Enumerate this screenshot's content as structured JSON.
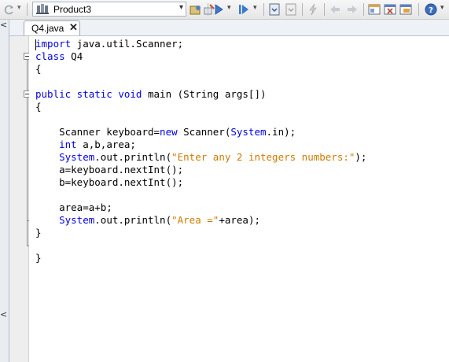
{
  "toolbar": {
    "project_name": "Product3"
  },
  "tab": {
    "label": "Q4.java",
    "close": "✕"
  },
  "code": {
    "lines": [
      [
        {
          "t": "import",
          "k": "kw"
        },
        {
          "t": " java.util.Scanner;",
          "k": "n"
        }
      ],
      [
        {
          "t": "class",
          "k": "kw"
        },
        {
          "t": " Q4",
          "k": "n"
        }
      ],
      [
        {
          "t": "{",
          "k": "n"
        }
      ],
      [],
      [
        {
          "t": "public static void",
          "k": "kw"
        },
        {
          "t": " main (String args[])",
          "k": "n"
        }
      ],
      [
        {
          "t": "{",
          "k": "n"
        }
      ],
      [],
      [
        {
          "t": "    Scanner keyboard",
          "k": "n"
        },
        {
          "t": "=",
          "k": "op"
        },
        {
          "t": "new",
          "k": "kw"
        },
        {
          "t": " Scanner(",
          "k": "n"
        },
        {
          "t": "System",
          "k": "sys"
        },
        {
          "t": ".in);",
          "k": "n"
        }
      ],
      [
        {
          "t": "    ",
          "k": "n"
        },
        {
          "t": "int",
          "k": "kw"
        },
        {
          "t": " a,b,area;",
          "k": "n"
        }
      ],
      [
        {
          "t": "    ",
          "k": "n"
        },
        {
          "t": "System",
          "k": "sys"
        },
        {
          "t": ".out.println(",
          "k": "n"
        },
        {
          "t": "\"Enter any 2 integers numbers:\"",
          "k": "str"
        },
        {
          "t": ");",
          "k": "n"
        }
      ],
      [
        {
          "t": "    a=keyboard.nextInt();",
          "k": "n"
        }
      ],
      [
        {
          "t": "    b=keyboard.nextInt();",
          "k": "n"
        }
      ],
      [],
      [
        {
          "t": "    area=a+b;",
          "k": "n"
        }
      ],
      [
        {
          "t": "    ",
          "k": "n"
        },
        {
          "t": "System",
          "k": "sys"
        },
        {
          "t": ".out.println(",
          "k": "n"
        },
        {
          "t": "\"Area =\"",
          "k": "str"
        },
        {
          "t": "+area);",
          "k": "n"
        }
      ],
      [
        {
          "t": "}",
          "k": "n"
        }
      ],
      [],
      [
        {
          "t": "}",
          "k": "n"
        }
      ]
    ]
  },
  "colors": {
    "keyword": "#0000e6",
    "string": "#ce7b00",
    "system": "#0000e6"
  }
}
